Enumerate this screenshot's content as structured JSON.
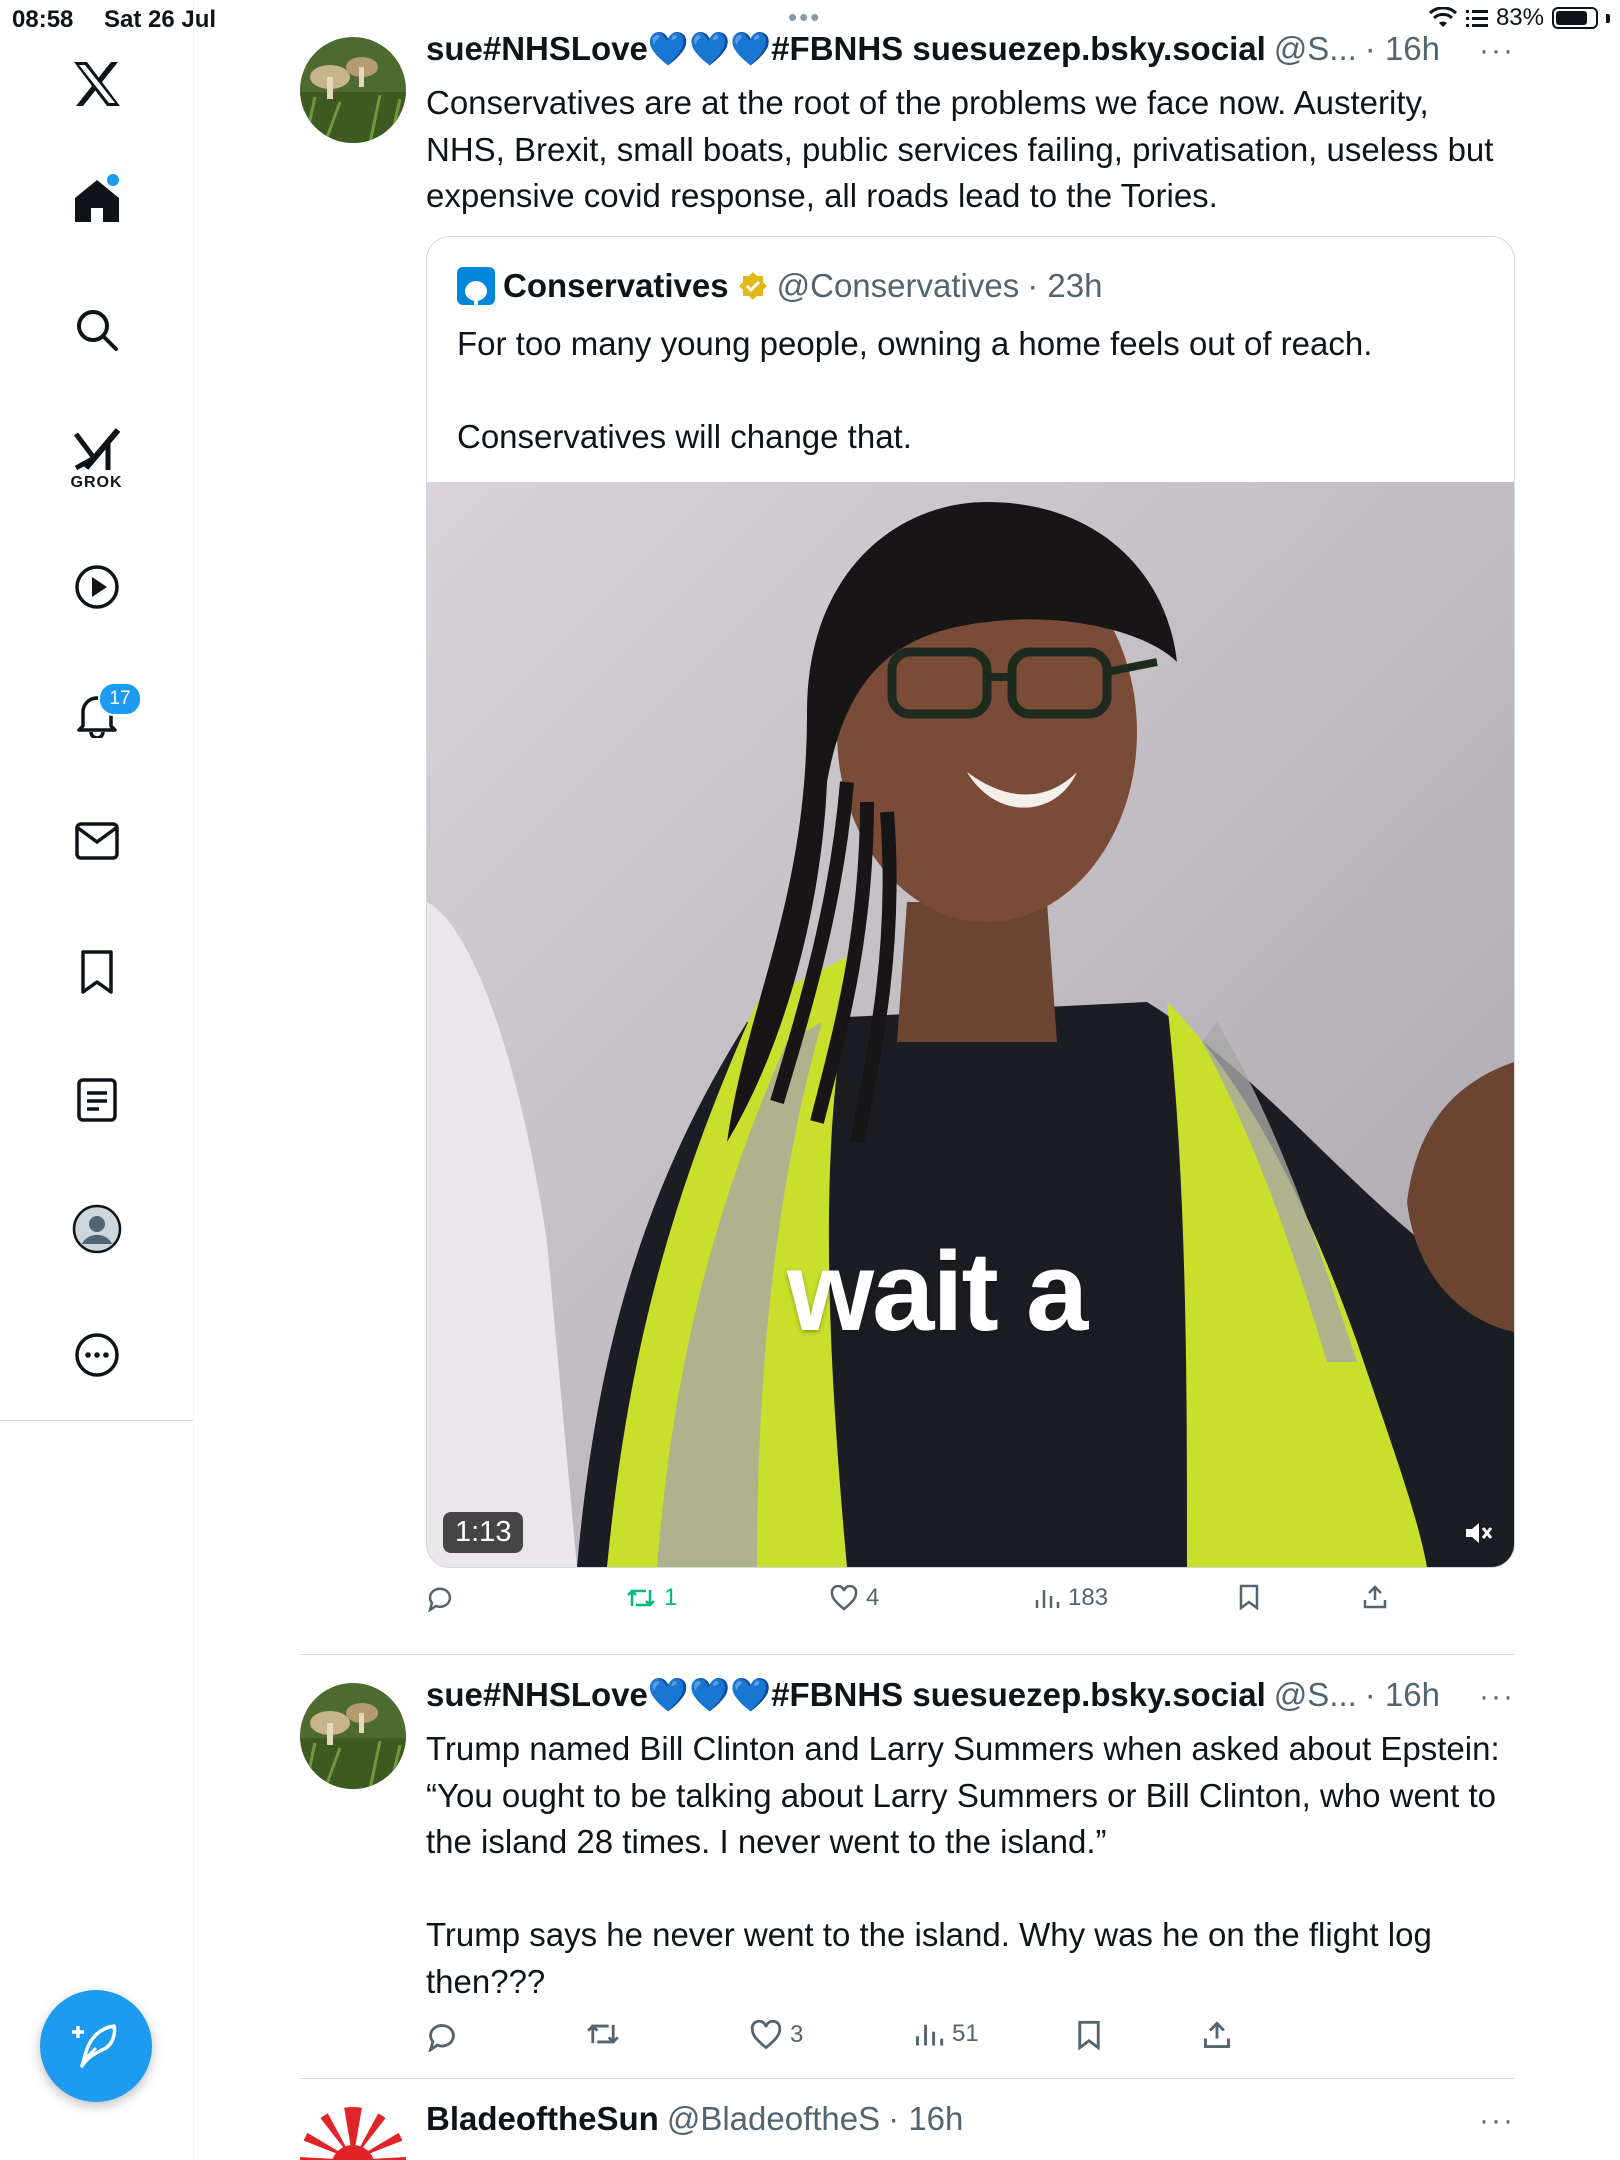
{
  "status_bar": {
    "time": "08:58",
    "date": "Sat 26 Jul",
    "battery": "83%",
    "battery_level": 0.83,
    "multitask_dots": "•••"
  },
  "sidebar": {
    "items": [
      {
        "name": "x-logo",
        "icon": "x-logo-icon"
      },
      {
        "name": "home",
        "icon": "home-icon"
      },
      {
        "name": "search",
        "icon": "search-icon"
      },
      {
        "name": "grok",
        "icon": "grok-icon",
        "label": "GROK"
      },
      {
        "name": "video",
        "icon": "play-icon"
      },
      {
        "name": "notifications",
        "icon": "bell-icon",
        "badge": "17"
      },
      {
        "name": "messages",
        "icon": "mail-icon"
      },
      {
        "name": "bookmarks",
        "icon": "bookmark-icon"
      },
      {
        "name": "lists",
        "icon": "list-icon"
      },
      {
        "name": "profile",
        "icon": "avatar-icon"
      },
      {
        "name": "more",
        "icon": "more-icon"
      }
    ],
    "compose": {
      "icon": "compose-icon"
    }
  },
  "tweets": [
    {
      "name": "sue#NHSLove💙💙💙#FBNHS suesuezep.bsky.social",
      "handle": "@S...",
      "time": "· 16h",
      "more": "···",
      "body": "Conservatives are at the root of the problems we face now. Austerity, NHS, Brexit, small boats, public services failing, privatisation, useless but expensive covid response, all roads lead to the Tories.",
      "quote": {
        "name": "Conservatives",
        "handle": "@Conservatives",
        "time": "· 23h",
        "body": "For too many young people, owning a home feels out of reach.\n\nConservatives will change that.",
        "video_caption": "wait a",
        "video_duration": "1:13"
      },
      "stats": {
        "replies": "",
        "retweets": "1",
        "likes": "4",
        "views": "183"
      }
    },
    {
      "name": "sue#NHSLove💙💙💙#FBNHS suesuezep.bsky.social",
      "handle": "@S...",
      "time": "· 16h",
      "more": "···",
      "body": "Trump named Bill Clinton and Larry Summers when asked about Epstein:  “You ought to be talking about Larry Summers or Bill Clinton, who went to the island 28 times. I never went to the island.”\n\nTrump says he never went to the island. Why was he on the flight log then???",
      "stats": {
        "replies": "",
        "retweets": "",
        "likes": "3",
        "views": "51"
      }
    },
    {
      "name": "BladeoftheSun",
      "handle": "@BladeoftheS",
      "time": "· 16h",
      "more": "···"
    }
  ],
  "colors": {
    "accent": "#1d9bf0",
    "retweet_active": "#00ba7c",
    "muted": "#536471",
    "border": "#cfd9de"
  }
}
